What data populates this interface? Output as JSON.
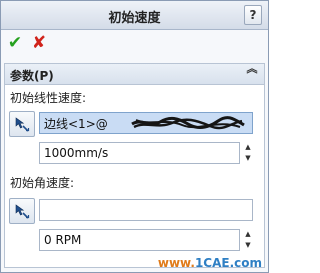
{
  "dialog": {
    "title": "初始速度",
    "help_label": "?"
  },
  "actions": {
    "ok_glyph": "✔",
    "cancel_glyph": "✘"
  },
  "panel": {
    "title": "参数(P)",
    "collapse_glyph": "︽"
  },
  "linear": {
    "label": "初始线性速度:",
    "reference_value": "边线<1>@",
    "speed_value": "1000mm/s"
  },
  "angular": {
    "label": "初始角速度:",
    "reference_value": "",
    "speed_value": "0 RPM"
  },
  "spinner": {
    "up_glyph": "▲",
    "down_glyph": "▼"
  },
  "watermark": {
    "prefix": "www.",
    "brand": "1CAE.com"
  },
  "icons": {
    "ok": "check-icon",
    "cancel": "close-icon",
    "pick": "arrow-select-icon"
  },
  "colors": {
    "accent_selection": "#c9dcf4",
    "ok": "#26a11f",
    "cancel": "#d0231b"
  }
}
